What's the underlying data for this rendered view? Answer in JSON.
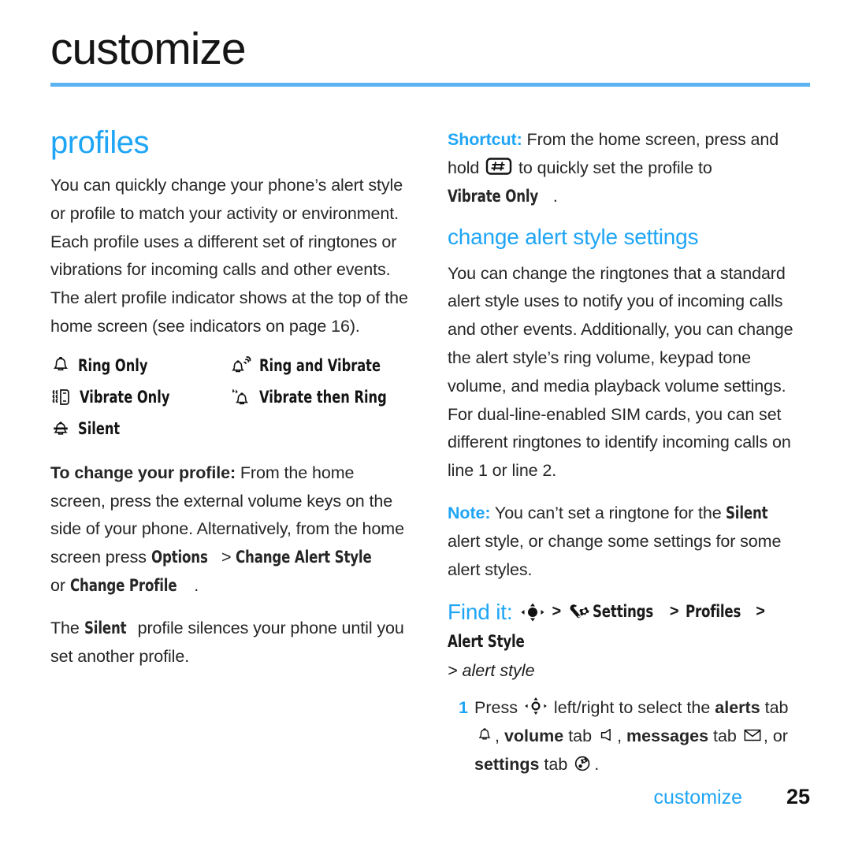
{
  "page": {
    "title": "customize",
    "footer_section": "customize",
    "footer_page_number": "25",
    "accent_blue": "#1FA5F5",
    "rule_blue": "#5CB3F2"
  },
  "left_column": {
    "section_heading": "profiles",
    "intro_paragraph": "You can quickly change your phone’s alert style or profile to match your activity or environment. Each profile uses a different set of ringtones or vibrations for incoming calls and other events. The alert profile indicator shows at the top of the home screen (see indicators on page 16).",
    "profiles": [
      {
        "icon": "bell-icon",
        "label": "Ring Only"
      },
      {
        "icon": "bell-vibrate-icon",
        "label": "Ring and Vibrate"
      },
      {
        "icon": "phone-vibrate-icon",
        "label": "Vibrate Only"
      },
      {
        "icon": "vibrate-then-ring-icon",
        "label": "Vibrate then Ring"
      },
      {
        "icon": "bell-silent-icon",
        "label": "Silent"
      }
    ],
    "change_profile": {
      "lead": "To change your profile:",
      "text_1": " From the home screen, press the external volume keys on the side of your phone. Alternatively, from the home screen press ",
      "ui_options": "Options",
      "sep_1": " > ",
      "ui_change_alert_style": "Change Alert Style",
      "text_2": " or ",
      "ui_change_profile": "Change Profile",
      "text_3": "."
    },
    "silent_paragraph": {
      "text_1": "The ",
      "ui_silent": "Silent",
      "text_2": " profile silences your phone until you set another profile."
    }
  },
  "right_column": {
    "shortcut": {
      "lead": "Shortcut:",
      "text_1": " From the home screen, press and hold ",
      "key_glyph": "hash-key-icon",
      "text_2": " to quickly set the profile to ",
      "ui_vibrate_only": "Vibrate Only",
      "text_3": "."
    },
    "subsection_heading": "change alert style settings",
    "body_paragraph": "You can change the ringtones that a standard alert style uses to notify you of incoming calls and other events. Additionally, you can change the alert style’s ring volume, keypad tone volume, and media playback volume settings. For dual-line-enabled SIM cards, you can set different ringtones to identify incoming calls on line 1 or line 2.",
    "note": {
      "lead": "Note:",
      "text_1": " You can’t set a ringtone for the ",
      "ui_silent": "Silent",
      "text_2": " alert style, or change some settings for some alert styles."
    },
    "find_it": {
      "lead": "Find it:",
      "nav_key_icon": "navigation-key-icon",
      "sep_1": ">",
      "settings_icon": "settings-wrench-gear-icon",
      "path_1": "Settings",
      "sep_2": ">",
      "path_2": "Profiles",
      "sep_3": ">",
      "path_3": "Alert Style",
      "sub_path": "> alert style"
    },
    "steps": [
      {
        "number": "1",
        "text_1": "Press ",
        "nav_icon": "navigation-key-icon",
        "text_2": " left/right to select the ",
        "bold_1": "alerts",
        "text_3": " tab ",
        "icon_1": "bell-icon",
        "text_4": ", ",
        "bold_2": "volume",
        "text_5": " tab ",
        "icon_2": "speaker-icon",
        "text_6": ", ",
        "bold_3": "messages",
        "text_7": " tab ",
        "icon_3": "envelope-icon",
        "text_8": ", or ",
        "bold_4": "settings",
        "text_9": " tab ",
        "icon_4": "settings-tab-icon",
        "text_10": "."
      }
    ]
  }
}
